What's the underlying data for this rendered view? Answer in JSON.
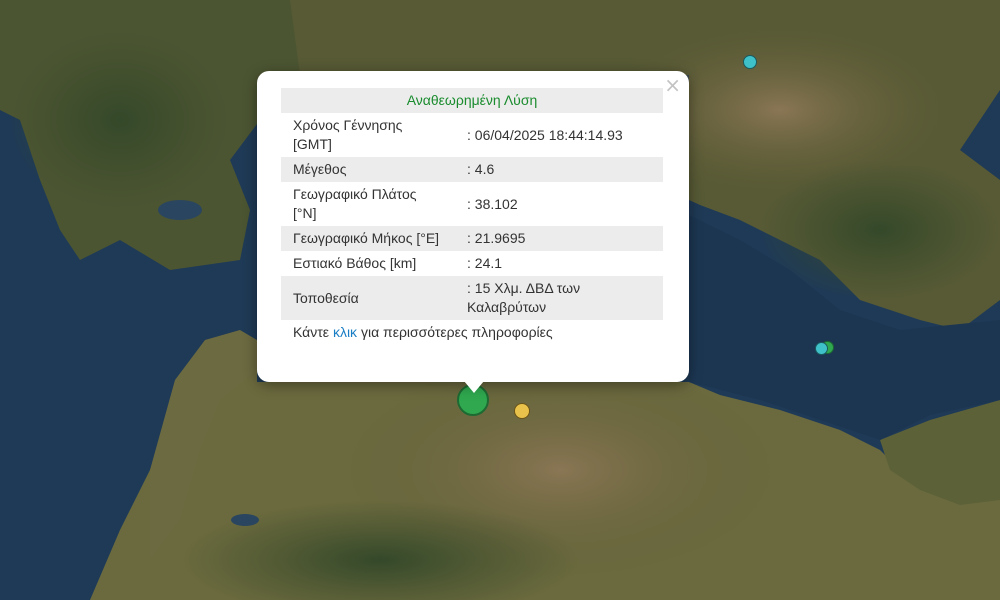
{
  "popup": {
    "title": "Αναθεωρημένη Λύση",
    "close_symbol": "×",
    "rows": [
      {
        "label": "Χρόνος Γέννησης [GMT]",
        "value": ": 06/04/2025 18:44:14.93"
      },
      {
        "label": "Μέγεθος",
        "value": ": 4.6"
      },
      {
        "label": "Γεωγραφικό Πλάτος [°N]",
        "value": ": 38.102"
      },
      {
        "label": "Γεωγραφικό Μήκος [°E]",
        "value": ": 21.9695"
      },
      {
        "label": "Εστιακό Βάθος [km]",
        "value": ": 24.1"
      },
      {
        "label": "Τοποθεσία",
        "value": ": 15 Χλμ. ΔΒΔ των Καλαβρύτων"
      }
    ],
    "more_prefix": "Κάντε",
    "more_link": "κλικ",
    "more_suffix": "για περισσότερες πληροφορίες"
  },
  "colors": {
    "sea": "#1f3a56",
    "land": "#6b6a3e",
    "mountain": "#7b6a4a",
    "forest": "#3b4f2a",
    "marker_main": "#2fa84f",
    "marker_yellow": "#e8c24a",
    "marker_cyan": "#3fc1c9"
  }
}
